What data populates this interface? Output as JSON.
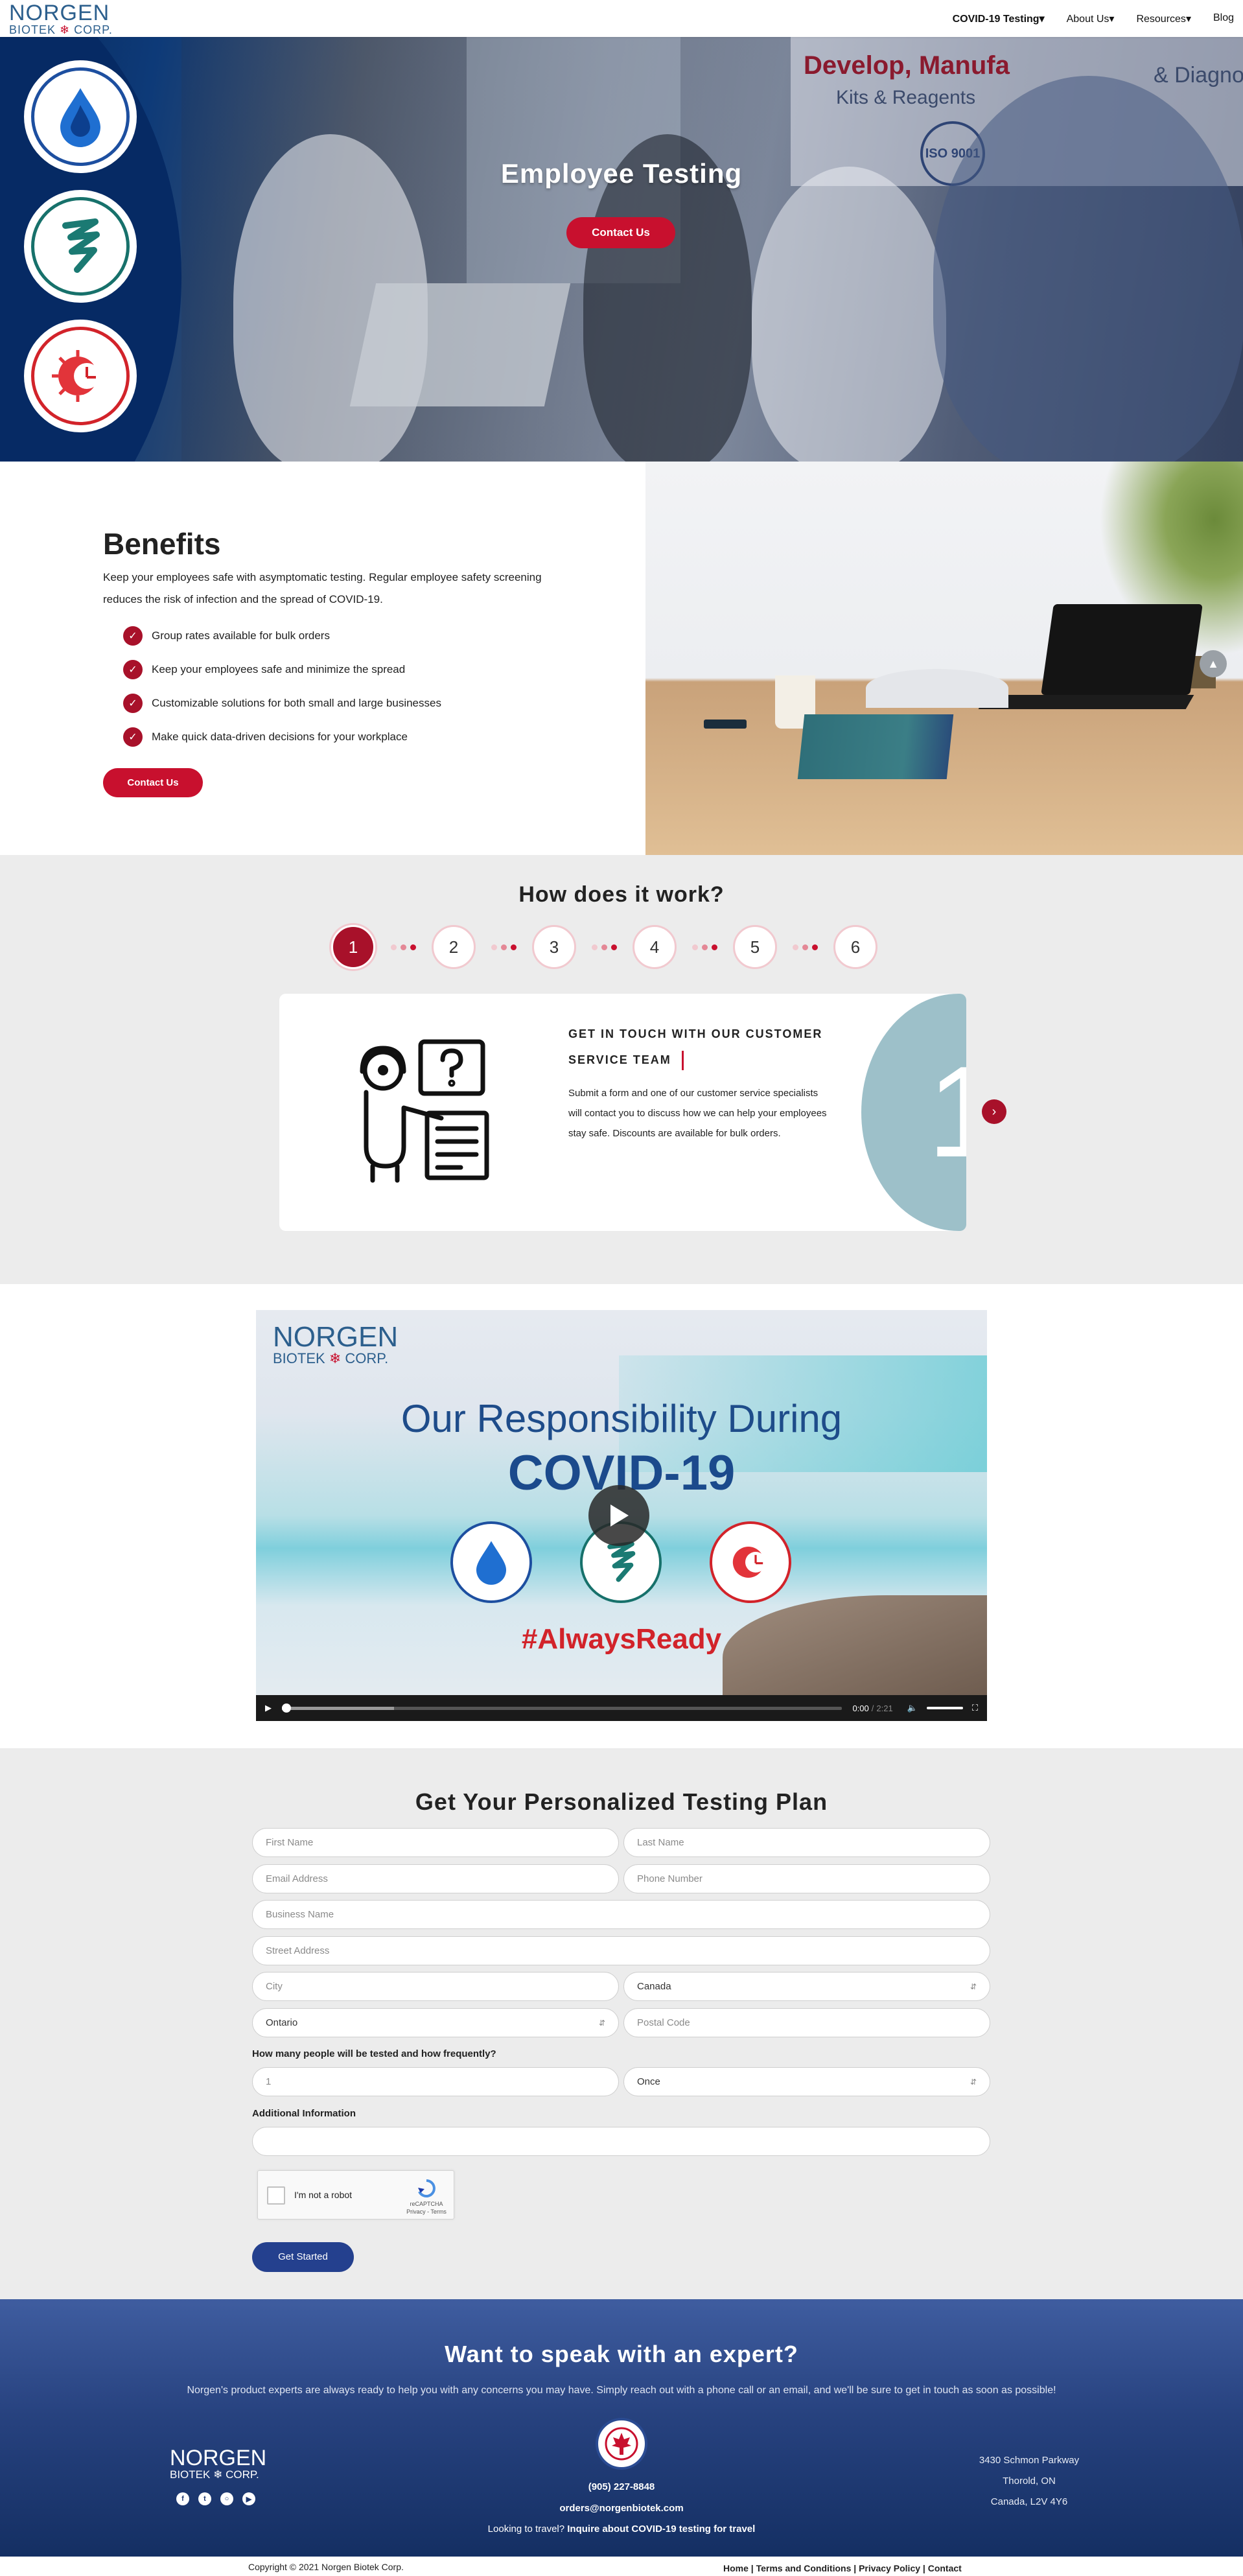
{
  "nav": {
    "logo_top": "NORGEN",
    "logo_bottom_left": "BIOTEK",
    "logo_bottom_right": "CORP.",
    "items": [
      {
        "label": "COVID-19 Testing"
      },
      {
        "label": "About Us"
      },
      {
        "label": "Resources"
      },
      {
        "label": "Blog"
      }
    ]
  },
  "hero": {
    "title": "Employee Testing",
    "cta": "Contact Us",
    "background_sign_1": "Develop, Manufa",
    "background_sign_2": "Kits & Reagents",
    "background_sign_3": "& Diagno",
    "iso_badge": "ISO 9001"
  },
  "benefits": {
    "title": "Benefits",
    "description": "Keep your employees safe with asymptomatic testing. Regular employee safety screening reduces the risk of infection and the spread of COVID-19.",
    "items": [
      "Group rates available for bulk orders",
      "Keep your employees safe and minimize the spread",
      "Customizable solutions for both small and large businesses",
      "Make quick data-driven decisions for your workplace"
    ],
    "cta": "Contact Us"
  },
  "how": {
    "title": "How does it work?",
    "steps": [
      "1",
      "2",
      "3",
      "4",
      "5",
      "6"
    ],
    "active_step": 1,
    "card_heading": "GET IN TOUCH WITH OUR CUSTOMER SERVICE TEAM",
    "card_text": "Submit a form and one of our customer service specialists will contact you to discuss how we can help your employees stay safe. Discounts are available for bulk orders.",
    "card_number": "1"
  },
  "video": {
    "logo_top": "NORGEN",
    "logo_bottom_left": "BIOTEK",
    "logo_bottom_right": "CORP.",
    "title_line1": "Our Responsibility During",
    "title_line2": "COVID-19",
    "hashtag": "#AlwaysReady",
    "time_current": "0:00",
    "time_total": "2:21",
    "progress": 0
  },
  "form": {
    "title": "Get Your Personalized Testing Plan",
    "first_name_ph": "First Name",
    "last_name_ph": "Last Name",
    "email_ph": "Email Address",
    "phone_ph": "Phone Number",
    "business_ph": "Business Name",
    "street_ph": "Street Address",
    "city_ph": "City",
    "country_value": "Canada",
    "province_value": "Ontario",
    "postal_ph": "Postal Code",
    "question_label": "How many people will be tested and how frequently?",
    "count_ph": "1",
    "frequency_value": "Once",
    "additional_label": "Additional Information",
    "recaptcha_label": "I'm not a robot",
    "recaptcha_brand": "reCAPTCHA",
    "recaptcha_terms": "Privacy - Terms",
    "submit": "Get Started"
  },
  "contact": {
    "title": "Want to speak with an expert?",
    "subtitle": "Norgen's product experts are always ready to help you with any concerns you may have. Simply reach out with a phone call or an email, and we'll be sure to get in touch as soon as possible!",
    "logo_top": "NORGEN",
    "logo_bottom_left": "BIOTEK",
    "logo_bottom_right": "CORP.",
    "phone": "(905) 227-8848",
    "email": "orders@norgenbiotek.com",
    "travel_prefix": "Looking to travel?",
    "travel_link": "Inquire about COVID-19 testing for travel",
    "address_1": "3430 Schmon Parkway",
    "address_2": "Thorold, ON",
    "address_3": "Canada, L2V 4Y6"
  },
  "footer": {
    "copyright": "Copyright © 2021 Norgen Biotek Corp.",
    "links": [
      "Home",
      "Terms and Conditions",
      "Privacy Policy",
      "Contact"
    ]
  },
  "colors": {
    "brand_red": "#c8102e",
    "brand_navy": "#24408e",
    "hero_navy": "#062a64",
    "teal": "#9dc0c9"
  },
  "icons": [
    "droplet-icon",
    "virus-spiral-icon",
    "virus-clock-icon",
    "checkmark-icon",
    "play-icon",
    "volume-icon",
    "fullscreen-icon",
    "facebook-icon",
    "twitter-icon",
    "instagram-icon",
    "youtube-icon",
    "scroll-top-icon",
    "next-arrow-icon"
  ]
}
